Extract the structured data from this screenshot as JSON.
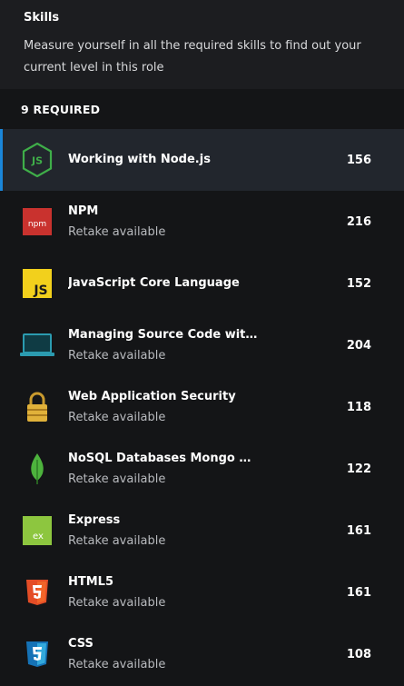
{
  "header": {
    "title": "Skills",
    "description": "Measure yourself in all the required skills to find out your current level in this role"
  },
  "required_label": "9 REQUIRED",
  "skills": [
    {
      "name": "Working with Node.js",
      "score": "156",
      "retake": "",
      "icon": "nodejs-icon"
    },
    {
      "name": "NPM",
      "score": "216",
      "retake": "Retake available",
      "icon": "npm-icon"
    },
    {
      "name": "JavaScript Core Language",
      "score": "152",
      "retake": "",
      "icon": "javascript-icon"
    },
    {
      "name": "Managing Source Code with Git",
      "score": "204",
      "retake": "Retake available",
      "icon": "laptop-icon"
    },
    {
      "name": "Web Application Security",
      "score": "118",
      "retake": "Retake available",
      "icon": "padlock-icon"
    },
    {
      "name": "NoSQL Databases Mongo Editi...",
      "score": "122",
      "retake": "Retake available",
      "icon": "mongodb-leaf-icon"
    },
    {
      "name": "Express",
      "score": "161",
      "retake": "Retake available",
      "icon": "express-icon"
    },
    {
      "name": "HTML5",
      "score": "161",
      "retake": "Retake available",
      "icon": "html5-icon"
    },
    {
      "name": "CSS",
      "score": "108",
      "retake": "Retake available",
      "icon": "css3-icon"
    }
  ],
  "colors": {
    "background": "#141517",
    "header_background": "#1c1d20",
    "active_row": "#22262d",
    "accent": "#1a86d9"
  }
}
